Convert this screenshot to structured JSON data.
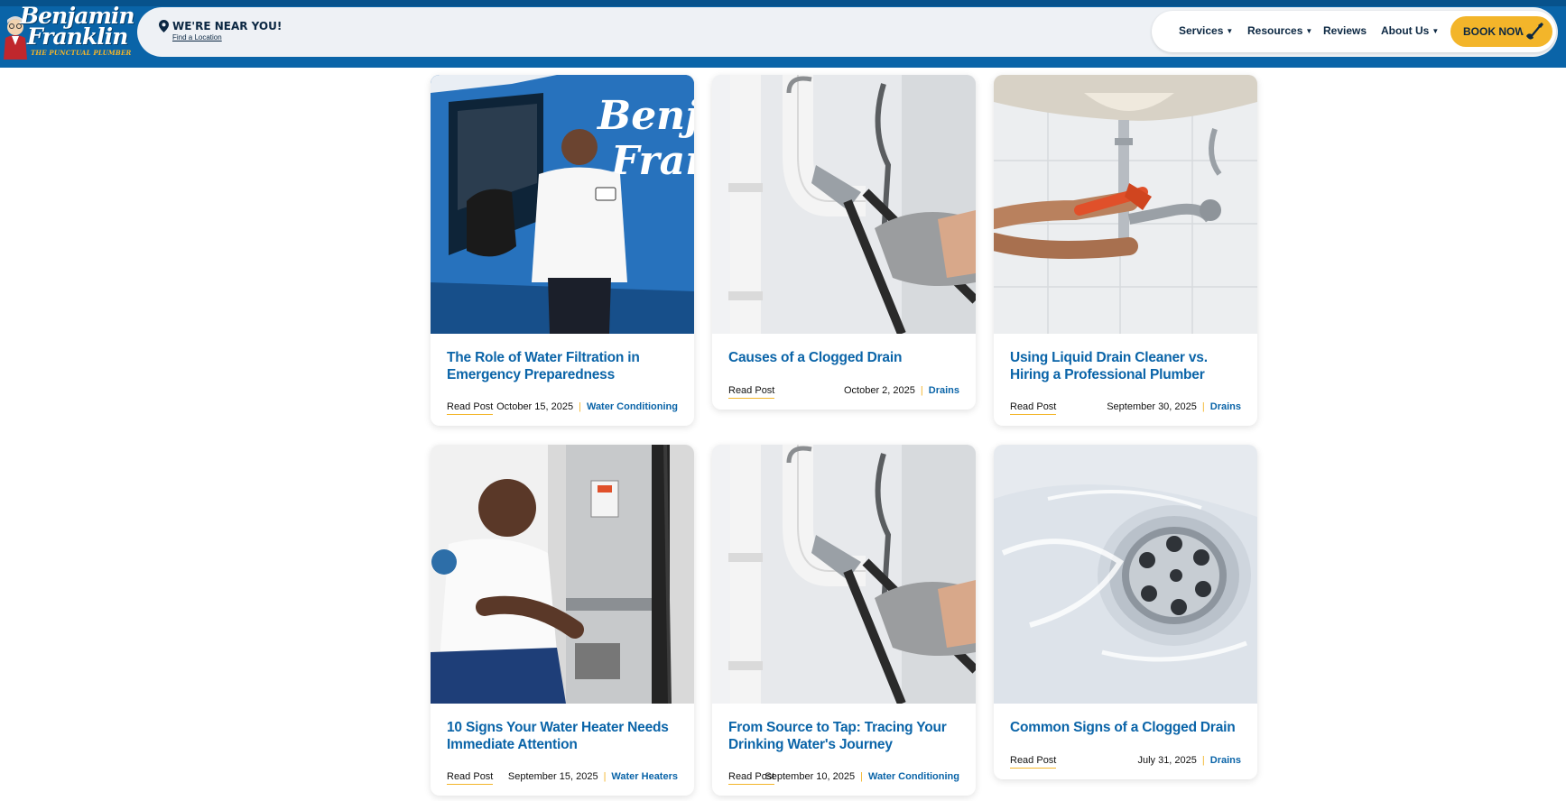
{
  "header": {
    "logo_name_line1": "Benjamin",
    "logo_name_line2": "Franklin",
    "logo_tagline": "THE PUNCTUAL PLUMBER",
    "near_title": "WE'RE NEAR YOU!",
    "near_link": "Find a Location",
    "nav": [
      {
        "label": "Services",
        "has_caret": true
      },
      {
        "label": "Resources",
        "has_caret": true
      },
      {
        "label": "Reviews",
        "has_caret": false
      },
      {
        "label": "About Us",
        "has_caret": true
      }
    ],
    "book_now": "BOOK NOW",
    "colors": {
      "brand_blue": "#0a64a8",
      "accent_yellow": "#f3b52a",
      "navy": "#0b2742"
    }
  },
  "posts": [
    {
      "title": "The Role of Water Filtration in Emergency Preparedness",
      "read": "Read Post",
      "date": "October 15, 2025",
      "category": "Water Conditioning",
      "image": "technician-with-van"
    },
    {
      "title": "Causes of a Clogged Drain",
      "read": "Read Post",
      "date": "October 2, 2025",
      "category": "Drains",
      "image": "wrench-on-p-trap"
    },
    {
      "title": "Using Liquid Drain Cleaner vs. Hiring a Professional Plumber",
      "read": "Read Post",
      "date": "September 30, 2025",
      "category": "Drains",
      "image": "hands-wrench-under-sink"
    },
    {
      "title": "10 Signs Your Water Heater Needs Immediate Attention",
      "read": "Read Post",
      "date": "September 15, 2025",
      "category": "Water Heaters",
      "image": "technician-water-heater"
    },
    {
      "title": "From Source to Tap: Tracing Your Drinking Water's Journey",
      "read": "Read Post",
      "date": "September 10, 2025",
      "category": "Water Conditioning",
      "image": "wrench-on-p-trap"
    },
    {
      "title": "Common Signs of a Clogged Drain",
      "read": "Read Post",
      "date": "July 31, 2025",
      "category": "Drains",
      "image": "water-swirling-drain"
    }
  ]
}
